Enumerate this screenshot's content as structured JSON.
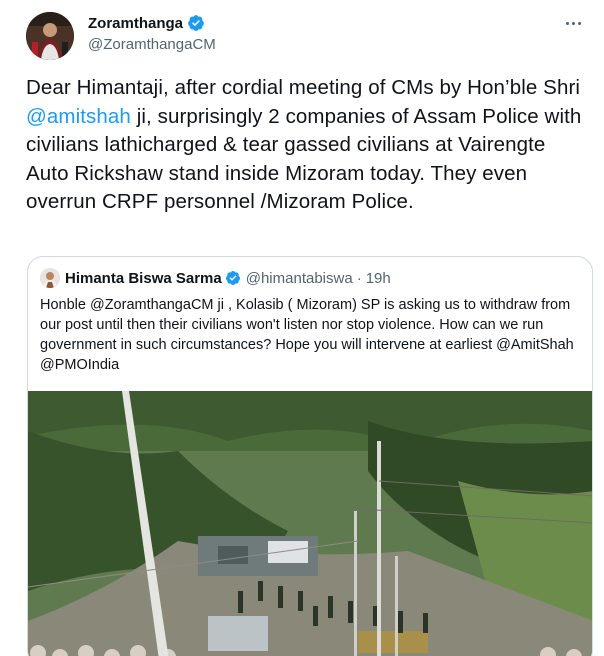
{
  "tweet": {
    "display_name": "Zoramthanga",
    "handle": "@ZoramthangaCM",
    "text_part1": "Dear Himantaji, after cordial meeting of CMs by Hon’ble Shri ",
    "mention": "@amitshah",
    "text_part2": " ji, surprisingly 2 companies of Assam Police with civilians lathicharged & tear gassed civilians at Vairengte Auto Rickshaw stand inside Mizoram today. They even overrun CRPF personnel /Mizoram Police.",
    "verified_icon": "verified-badge-icon",
    "more_icon": "more-options-icon"
  },
  "quoted_tweet": {
    "display_name": "Himanta Biswa Sarma",
    "handle": "@himantabiswa",
    "separator": "·",
    "time": "19h",
    "text": "Honble @ZoramthangaCM ji , Kolasib ( Mizoram) SP is asking us to withdraw from our post until then their civilians won't listen nor stop violence. How can we run government in such circumstances? Hope you will intervene at earliest @AmitShah @PMOIndia"
  },
  "colors": {
    "accent": "#1d9bf0",
    "text_primary": "#0f1419",
    "text_secondary": "#536471",
    "border": "#cfd9de"
  }
}
